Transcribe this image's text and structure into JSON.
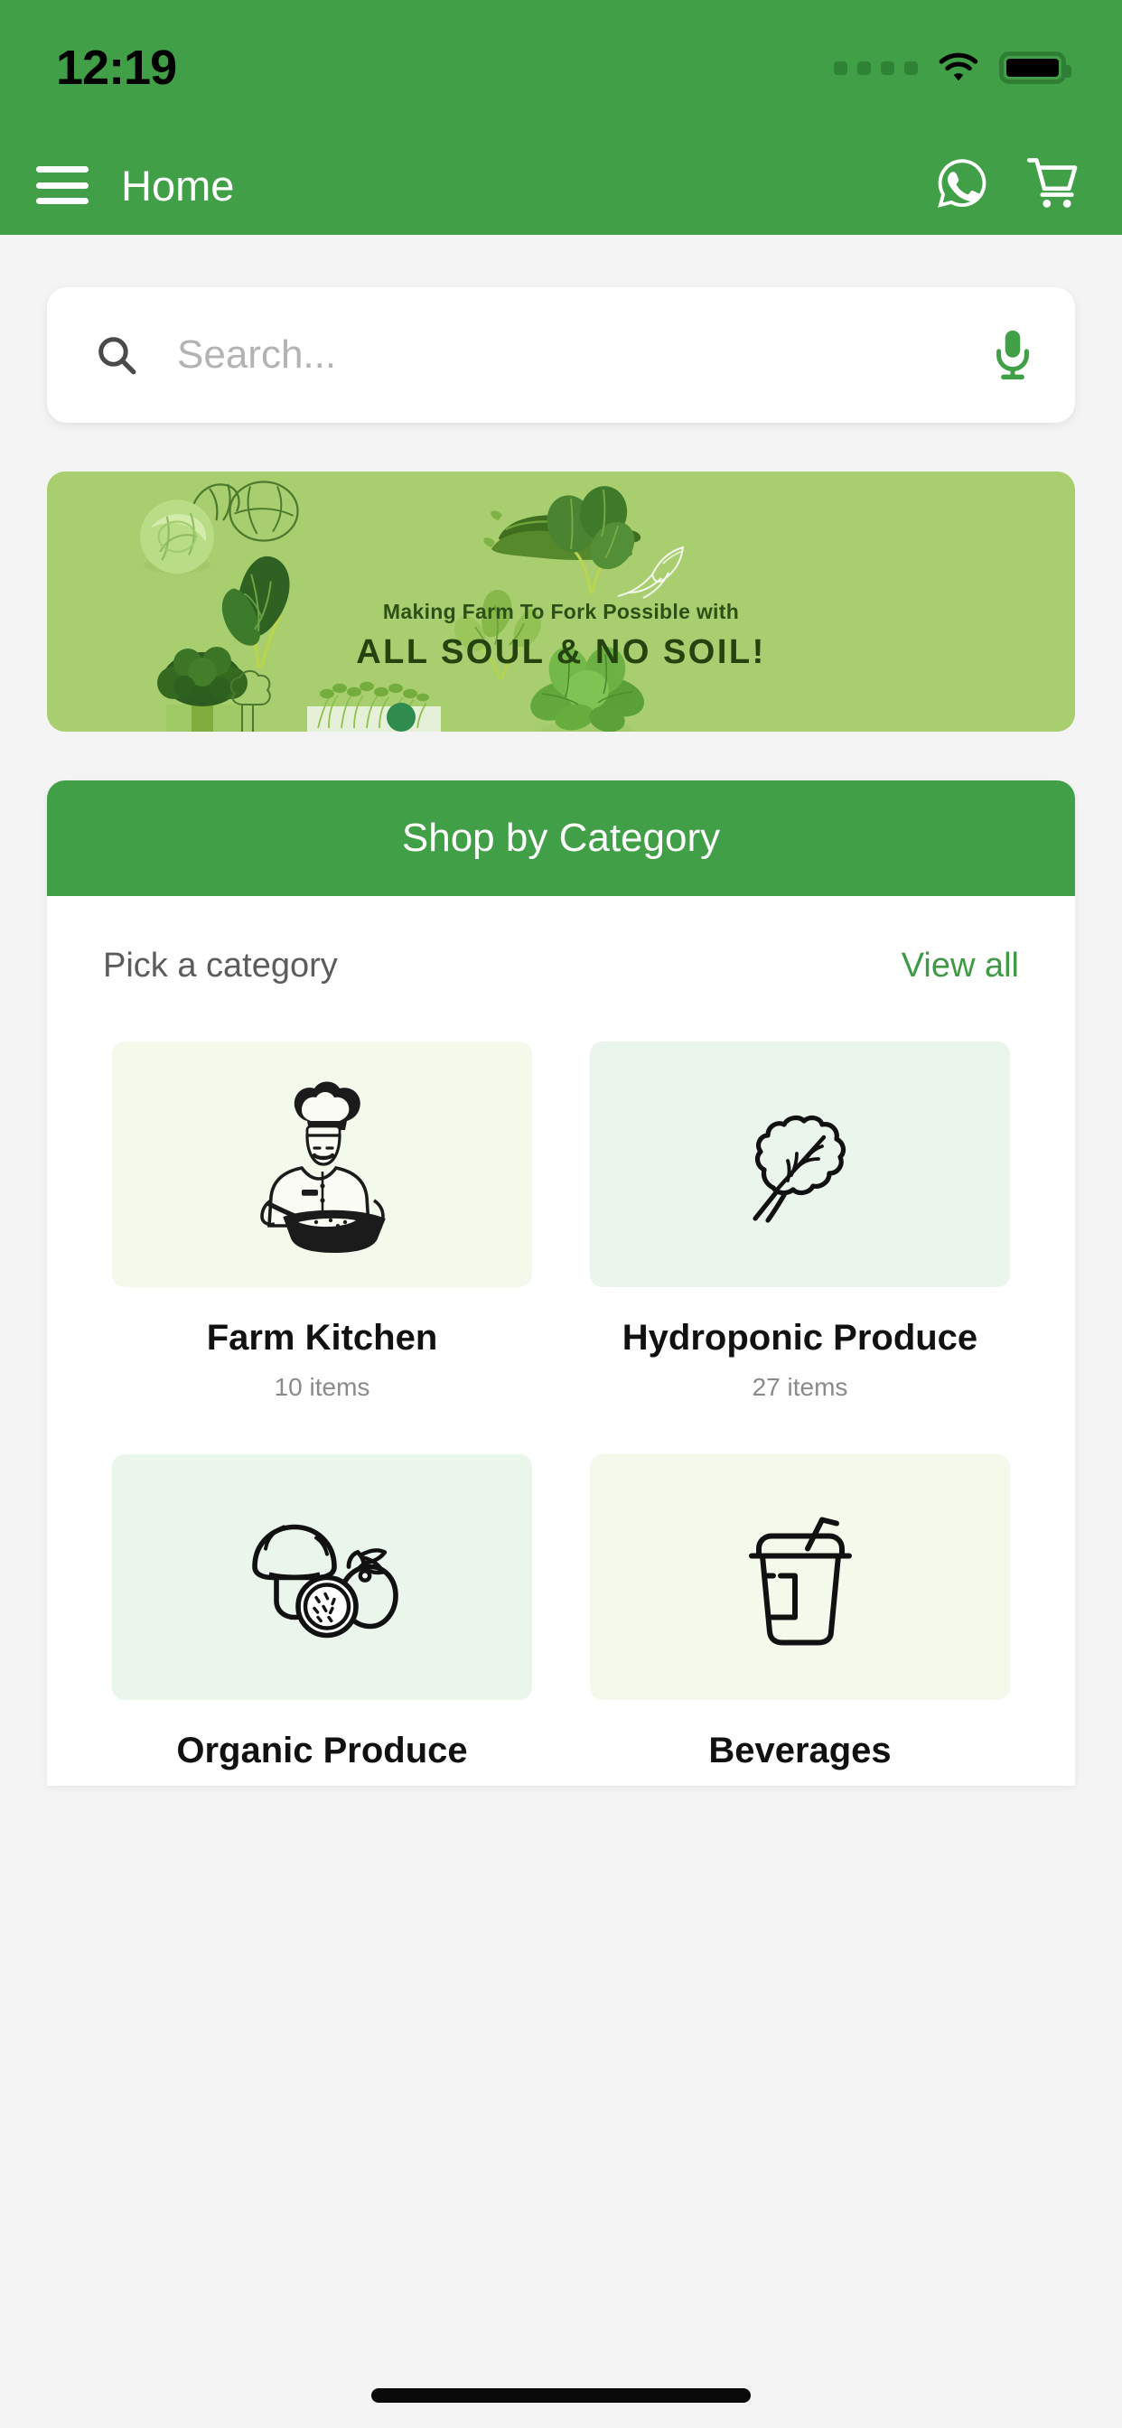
{
  "status_bar": {
    "time": "12:19",
    "signal_icon": "signal-dots-icon",
    "wifi_icon": "wifi-icon",
    "battery_icon": "battery-full-icon"
  },
  "app_bar": {
    "menu_icon": "hamburger-menu-icon",
    "title": "Home",
    "whatsapp_icon": "whatsapp-icon",
    "cart_icon": "shopping-cart-icon"
  },
  "search": {
    "placeholder": "Search...",
    "value": "",
    "search_icon": "search-icon",
    "mic_icon": "microphone-icon"
  },
  "banner": {
    "subtitle": "Making Farm To Fork Possible with",
    "headline": "ALL SOUL & NO SOIL!",
    "background_color": "#a9ce70",
    "text_color": "#24430f",
    "produce": [
      "cabbage",
      "cabbage-line-art",
      "zucchini",
      "kale",
      "broccoli",
      "broccoli-line-art",
      "arugula",
      "spinach",
      "spinach-line-art",
      "microgreens",
      "basil"
    ]
  },
  "category_section": {
    "header_title": "Shop by Category",
    "header_color": "#41a047",
    "subtitle": "Pick a category",
    "view_all_label": "View all",
    "view_all_color": "#3f9a45",
    "items": [
      {
        "name": "Farm Kitchen",
        "count": "10 items",
        "icon": "chef-icon",
        "tile_color": "#f3faec"
      },
      {
        "name": "Hydroponic Produce",
        "count": "27 items",
        "icon": "leafy-green-icon",
        "tile_color": "#eaf5ec"
      },
      {
        "name": "Organic Produce",
        "count": "",
        "icon": "mushroom-fruit-icon",
        "tile_color": "#eaf5ec"
      },
      {
        "name": "Beverages",
        "count": "",
        "icon": "drink-cup-icon",
        "tile_color": "#f3faec"
      }
    ]
  },
  "colors": {
    "brand_green": "#41a047",
    "banner_green": "#a9ce70",
    "page_background": "#f4f4f4"
  }
}
